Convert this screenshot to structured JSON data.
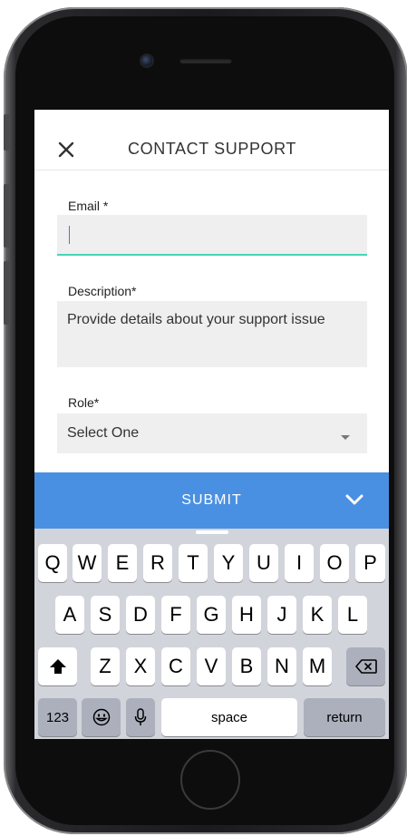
{
  "header": {
    "title": "CONTACT SUPPORT",
    "close_icon": "close-icon"
  },
  "form": {
    "email": {
      "label": "Email *",
      "value": "",
      "focused": true
    },
    "description": {
      "label": "Description*",
      "placeholder": "Provide details about your support issue"
    },
    "role": {
      "label": "Role*",
      "selected": "Select One"
    }
  },
  "submit": {
    "label": "SUBMIT",
    "icon": "chevron-down-icon"
  },
  "keyboard": {
    "row1": [
      "Q",
      "W",
      "E",
      "R",
      "T",
      "Y",
      "U",
      "I",
      "O",
      "P"
    ],
    "row2": [
      "A",
      "S",
      "D",
      "F",
      "G",
      "H",
      "J",
      "K",
      "L"
    ],
    "row3": [
      "Z",
      "X",
      "C",
      "V",
      "B",
      "N",
      "M"
    ],
    "numbers_label": "123",
    "space_label": "space",
    "return_label": "return"
  },
  "colors": {
    "accent_blue": "#4a90e2",
    "focus_underline": "#48d5b5",
    "keyboard_bg": "#d1d4da"
  }
}
